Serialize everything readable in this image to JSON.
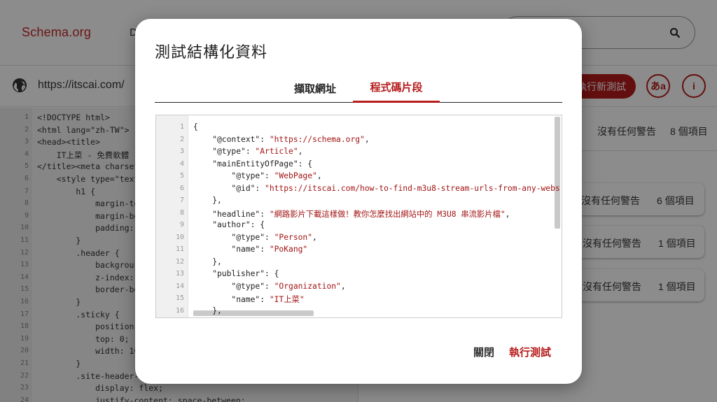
{
  "header": {
    "brand": "Schema.org",
    "nav_partial": "D"
  },
  "urlbar": {
    "url": "https://itscai.com/",
    "run_new_label": "執行新測試",
    "lang_label": "あa",
    "info_label": "i"
  },
  "background_code": [
    {
      "n": "1",
      "t": "<!DOCTYPE html>"
    },
    {
      "n": "2",
      "t": "<html lang=\"zh-TW\">"
    },
    {
      "n": "3",
      "t": "<head><title>"
    },
    {
      "n": "4",
      "t": "    IT上菜 - 免費軟體"
    },
    {
      "n": "5",
      "t": "</title><meta charset"
    },
    {
      "n": "6",
      "t": "    <style type=\"text"
    },
    {
      "n": "7",
      "t": "        h1 {"
    },
    {
      "n": "8",
      "t": "            margin-to"
    },
    {
      "n": "9",
      "t": "            margin-bo"
    },
    {
      "n": "10",
      "t": "            padding:"
    },
    {
      "n": "11",
      "t": "        }"
    },
    {
      "n": "12",
      "t": "        .header {"
    },
    {
      "n": "13",
      "t": "            backgrou"
    },
    {
      "n": "14",
      "t": "            z-index:"
    },
    {
      "n": "15",
      "t": "            border-bo"
    },
    {
      "n": "16",
      "t": "        }"
    },
    {
      "n": "17",
      "t": "        .sticky {"
    },
    {
      "n": "18",
      "t": "            position"
    },
    {
      "n": "19",
      "t": "            top: 0;"
    },
    {
      "n": "20",
      "t": "            width: 10"
    },
    {
      "n": "21",
      "t": "        }"
    },
    {
      "n": "22",
      "t": "        .site-header-"
    },
    {
      "n": "23",
      "t": "            display: flex;"
    },
    {
      "n": "24",
      "t": "            justify-content: space-between;"
    }
  ],
  "results": {
    "header_warnings": "沒有任何警告",
    "header_count": "8 個項目",
    "cards": [
      {
        "warnings": "沒有任何警告",
        "count": "6 個項目"
      },
      {
        "warnings": "沒有任何警告",
        "count": "1 個項目"
      },
      {
        "warnings": "沒有任何警告",
        "count": "1 個項目"
      }
    ]
  },
  "modal": {
    "title": "測試結構化資料",
    "tabs": [
      {
        "label": "擷取網址"
      },
      {
        "label": "程式碼片段"
      }
    ],
    "code_lines": [
      {
        "n": "1",
        "k": "{",
        "v": "",
        "e": ""
      },
      {
        "n": "2",
        "k": "    \"@context\": ",
        "v": "\"https://schema.org\"",
        "e": ","
      },
      {
        "n": "3",
        "k": "    \"@type\": ",
        "v": "\"Article\"",
        "e": ","
      },
      {
        "n": "4",
        "k": "    \"mainEntityOfPage\": {",
        "v": "",
        "e": ""
      },
      {
        "n": "5",
        "k": "        \"@type\": ",
        "v": "\"WebPage\"",
        "e": ","
      },
      {
        "n": "6",
        "k": "        \"@id\": ",
        "v": "\"https://itscai.com/how-to-find-m3u8-stream-urls-from-any-webs",
        "e": ""
      },
      {
        "n": "7",
        "k": "    },",
        "v": "",
        "e": ""
      },
      {
        "n": "8",
        "k": "    \"headline\": ",
        "v": "\"網路影片下載這樣做！教你怎麼找出網站中的 M3U8 串流影片檔\"",
        "e": ","
      },
      {
        "n": "9",
        "k": "    \"author\": {",
        "v": "",
        "e": ""
      },
      {
        "n": "10",
        "k": "        \"@type\": ",
        "v": "\"Person\"",
        "e": ","
      },
      {
        "n": "11",
        "k": "        \"name\": ",
        "v": "\"PoKang\"",
        "e": ""
      },
      {
        "n": "12",
        "k": "    },",
        "v": "",
        "e": ""
      },
      {
        "n": "13",
        "k": "    \"publisher\": {",
        "v": "",
        "e": ""
      },
      {
        "n": "14",
        "k": "        \"@type\": ",
        "v": "\"Organization\"",
        "e": ","
      },
      {
        "n": "15",
        "k": "        \"name\": ",
        "v": "\"IT上菜\"",
        "e": ""
      },
      {
        "n": "16",
        "k": "    },",
        "v": "",
        "e": ""
      }
    ],
    "close_label": "關閉",
    "run_label": "執行測試"
  },
  "colors": {
    "accent": "#b71c1c",
    "string": "#a31515"
  }
}
